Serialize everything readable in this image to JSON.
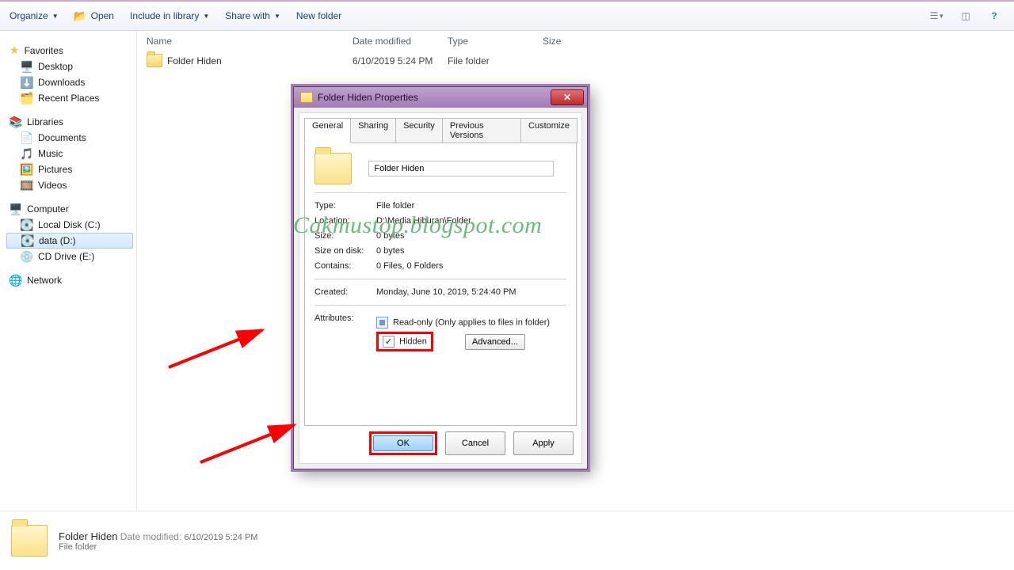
{
  "toolbar": {
    "organize": "Organize",
    "open": "Open",
    "include": "Include in library",
    "share": "Share with",
    "new_folder": "New folder"
  },
  "nav": {
    "favorites": "Favorites",
    "fav_items": [
      "Desktop",
      "Downloads",
      "Recent Places"
    ],
    "libraries": "Libraries",
    "lib_items": [
      "Documents",
      "Music",
      "Pictures",
      "Videos"
    ],
    "computer": "Computer",
    "drives": [
      "Local Disk (C:)",
      "data (D:)",
      "CD Drive (E:)"
    ],
    "network": "Network"
  },
  "cols": {
    "c1": "Name",
    "c2": "Date modified",
    "c3": "Type",
    "c4": "Size"
  },
  "file": {
    "name": "Folder Hiden",
    "date": "6/10/2019 5:24 PM",
    "type": "File folder"
  },
  "dlg": {
    "title": "Folder Hiden Properties",
    "tabs": [
      "General",
      "Sharing",
      "Security",
      "Previous Versions",
      "Customize"
    ],
    "name": "Folder Hiden",
    "type_l": "Type:",
    "type_v": "File folder",
    "loc_l": "Location:",
    "loc_v": "D:\\Media Hiburan\\Folder",
    "size_l": "Size:",
    "size_v": "0 bytes",
    "sod_l": "Size on disk:",
    "sod_v": "0 bytes",
    "con_l": "Contains:",
    "con_v": "0 Files, 0 Folders",
    "cre_l": "Created:",
    "cre_v": "Monday, June 10, 2019, 5:24:40 PM",
    "attr_l": "Attributes:",
    "ro": "Read-only (Only applies to files in folder)",
    "hidden": "Hidden",
    "advanced": "Advanced...",
    "ok": "OK",
    "cancel": "Cancel",
    "apply": "Apply"
  },
  "watermark": "Cakmustop.blogspot.com",
  "details": {
    "name": "Folder Hiden",
    "dm_l": "Date modified:",
    "dm_v": "6/10/2019 5:24 PM",
    "type": "File folder"
  }
}
